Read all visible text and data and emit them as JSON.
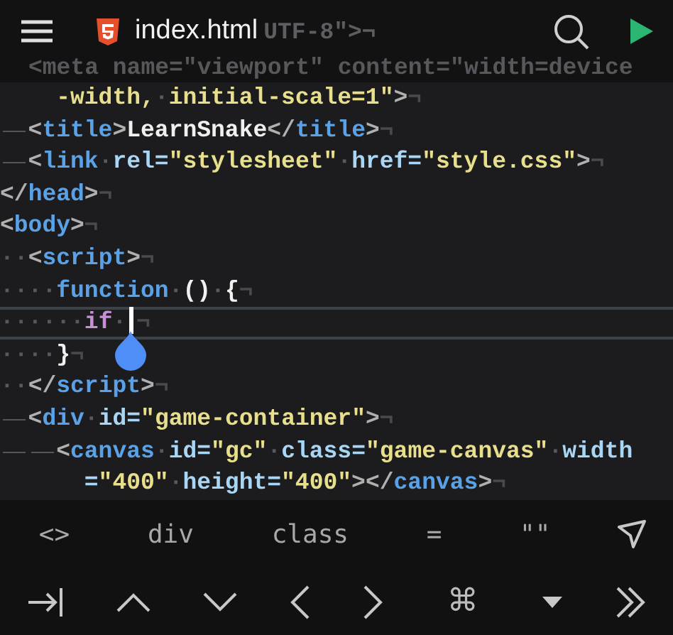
{
  "header": {
    "title": "index.html",
    "behind_fragment": "UTF-8\">¬",
    "behind_line": "<meta name=\"viewport\" content=\"width=device"
  },
  "code_lines": [
    {
      "current": false,
      "tokens": [
        {
          "kind": "space"
        },
        {
          "kind": "space"
        },
        {
          "kind": "string",
          "text": "-width,"
        },
        {
          "kind": "ws",
          "text": "·"
        },
        {
          "kind": "string",
          "text": "initial-scale=1\""
        },
        {
          "kind": "punct",
          "text": ">"
        },
        {
          "kind": "eol",
          "text": "¬"
        }
      ]
    },
    {
      "current": false,
      "tokens": [
        {
          "kind": "tab"
        },
        {
          "kind": "punct",
          "text": "<"
        },
        {
          "kind": "tag",
          "text": "title"
        },
        {
          "kind": "punct",
          "text": ">"
        },
        {
          "kind": "plain",
          "text": "LearnSnake"
        },
        {
          "kind": "punct",
          "text": "</"
        },
        {
          "kind": "tag",
          "text": "title"
        },
        {
          "kind": "punct",
          "text": ">"
        },
        {
          "kind": "eol",
          "text": "¬"
        }
      ]
    },
    {
      "current": false,
      "tokens": [
        {
          "kind": "tab"
        },
        {
          "kind": "punct",
          "text": "<"
        },
        {
          "kind": "tag",
          "text": "link"
        },
        {
          "kind": "ws",
          "text": "·"
        },
        {
          "kind": "attr",
          "text": "rel="
        },
        {
          "kind": "string",
          "text": "\"stylesheet\""
        },
        {
          "kind": "ws",
          "text": "·"
        },
        {
          "kind": "attr",
          "text": "href="
        },
        {
          "kind": "string",
          "text": "\"style.css\""
        },
        {
          "kind": "punct",
          "text": ">"
        },
        {
          "kind": "eol",
          "text": "¬"
        }
      ]
    },
    {
      "current": false,
      "tokens": [
        {
          "kind": "punct",
          "text": "</"
        },
        {
          "kind": "tag",
          "text": "head"
        },
        {
          "kind": "punct",
          "text": ">"
        },
        {
          "kind": "eol",
          "text": "¬"
        }
      ]
    },
    {
      "current": false,
      "tokens": [
        {
          "kind": "punct",
          "text": "<"
        },
        {
          "kind": "tag",
          "text": "body"
        },
        {
          "kind": "punct",
          "text": ">"
        },
        {
          "kind": "eol",
          "text": "¬"
        }
      ]
    },
    {
      "current": false,
      "tokens": [
        {
          "kind": "ws",
          "text": "··"
        },
        {
          "kind": "punct",
          "text": "<"
        },
        {
          "kind": "tag",
          "text": "script"
        },
        {
          "kind": "punct",
          "text": ">"
        },
        {
          "kind": "eol",
          "text": "¬"
        }
      ]
    },
    {
      "current": false,
      "tokens": [
        {
          "kind": "ws",
          "text": "····"
        },
        {
          "kind": "tag",
          "text": "function"
        },
        {
          "kind": "ws",
          "text": "·"
        },
        {
          "kind": "plain",
          "text": "()"
        },
        {
          "kind": "ws",
          "text": "·"
        },
        {
          "kind": "plain",
          "text": "{"
        },
        {
          "kind": "eol",
          "text": "¬"
        }
      ]
    },
    {
      "current": true,
      "tokens": [
        {
          "kind": "ws",
          "text": "······"
        },
        {
          "kind": "keyword",
          "text": "if"
        },
        {
          "kind": "ws",
          "text": "·"
        },
        {
          "kind": "cursor"
        },
        {
          "kind": "eol",
          "text": "¬"
        }
      ]
    },
    {
      "current": false,
      "tokens": [
        {
          "kind": "ws",
          "text": "····"
        },
        {
          "kind": "plain",
          "text": "}"
        },
        {
          "kind": "eol",
          "text": "¬"
        }
      ]
    },
    {
      "current": false,
      "tokens": [
        {
          "kind": "ws",
          "text": "··"
        },
        {
          "kind": "punct",
          "text": "</"
        },
        {
          "kind": "tag",
          "text": "script"
        },
        {
          "kind": "punct",
          "text": ">"
        },
        {
          "kind": "eol",
          "text": "¬"
        }
      ]
    },
    {
      "current": false,
      "tokens": [
        {
          "kind": "tab"
        },
        {
          "kind": "punct",
          "text": "<"
        },
        {
          "kind": "tag",
          "text": "div"
        },
        {
          "kind": "ws",
          "text": "·"
        },
        {
          "kind": "attr",
          "text": "id="
        },
        {
          "kind": "string",
          "text": "\"game-container\""
        },
        {
          "kind": "punct",
          "text": ">"
        },
        {
          "kind": "eol",
          "text": "¬"
        }
      ]
    },
    {
      "current": false,
      "tokens": [
        {
          "kind": "tab"
        },
        {
          "kind": "tab"
        },
        {
          "kind": "punct",
          "text": "<"
        },
        {
          "kind": "tag",
          "text": "canvas"
        },
        {
          "kind": "ws",
          "text": "·"
        },
        {
          "kind": "attr",
          "text": "id="
        },
        {
          "kind": "string",
          "text": "\"gc\""
        },
        {
          "kind": "ws",
          "text": "·"
        },
        {
          "kind": "attr",
          "text": "class="
        },
        {
          "kind": "string",
          "text": "\"game-canvas\""
        },
        {
          "kind": "ws",
          "text": "·"
        },
        {
          "kind": "attr",
          "text": "width"
        }
      ]
    },
    {
      "current": false,
      "tokens": [
        {
          "kind": "space"
        },
        {
          "kind": "space"
        },
        {
          "kind": "space"
        },
        {
          "kind": "attr",
          "text": "="
        },
        {
          "kind": "string",
          "text": "\"400\""
        },
        {
          "kind": "ws",
          "text": "·"
        },
        {
          "kind": "attr",
          "text": "height="
        },
        {
          "kind": "string",
          "text": "\"400\""
        },
        {
          "kind": "punct",
          "text": "></"
        },
        {
          "kind": "tag",
          "text": "canvas"
        },
        {
          "kind": "punct",
          "text": ">"
        },
        {
          "kind": "eol",
          "text": "¬"
        }
      ]
    }
  ],
  "snippet_keys": [
    "<>",
    "div",
    "class",
    "=",
    "\"\""
  ],
  "command_key": "⌘"
}
